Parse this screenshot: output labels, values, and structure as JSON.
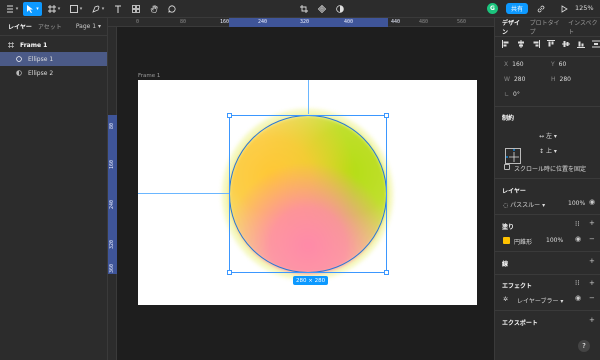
{
  "toolbar": {
    "share_label": "共有",
    "zoom": "125%",
    "avatar_initial": "G"
  },
  "left_panel": {
    "tabs": [
      "レイヤー",
      "アセット"
    ],
    "page_selector": "Page 1",
    "layers": [
      {
        "name": "Frame 1",
        "icon": "frame-icon"
      },
      {
        "name": "Ellipse 1",
        "icon": "ellipse-icon"
      },
      {
        "name": "Ellipse 2",
        "icon": "ellipse-filled-icon"
      }
    ]
  },
  "canvas": {
    "frame_label": "Frame 1",
    "size_label": "280 × 280",
    "ruler_top": [
      "0",
      "80",
      "160",
      "240",
      "320",
      "400",
      "440",
      "480",
      "560",
      "640"
    ],
    "ruler_left": [
      "80",
      "160",
      "240",
      "320",
      "360"
    ]
  },
  "right_panel": {
    "tabs": [
      "デザイン",
      "プロトタイプ",
      "インスペクト"
    ],
    "x_label": "X",
    "x_value": "160",
    "y_label": "Y",
    "y_value": "60",
    "w_label": "W",
    "w_value": "280",
    "h_label": "H",
    "h_value": "280",
    "rotation_label": "∟",
    "rotation_value": "0°",
    "constraints_title": "制約",
    "constraint_h": "左",
    "constraint_v": "上",
    "scroll_fix_label": "スクロール時に位置を固定",
    "layer_title": "レイヤー",
    "blend_mode": "パススルー",
    "layer_opacity": "100%",
    "fill_title": "塗り",
    "fill_name": "円錐形",
    "fill_opacity": "100%",
    "fill_color": "#ffc200",
    "stroke_title": "線",
    "effect_title": "エフェクト",
    "effect_name": "レイヤーブラー",
    "export_title": "エクスポート"
  },
  "help_label": "?"
}
